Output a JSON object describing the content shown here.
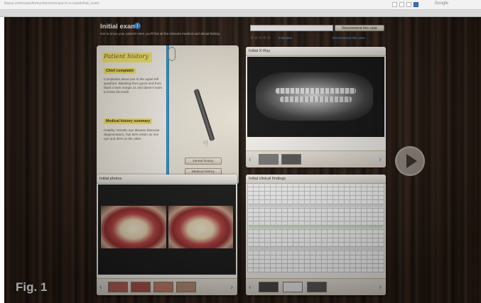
{
  "browser": {
    "url": "itepus.com/cases/tomuchtersom/case-in-a-case/initial_exam",
    "search_hint": "Google"
  },
  "header": {
    "title": "Initial exam",
    "subtitle": "Get to know your patient! Here you'll find all the relevant medical and dental history",
    "comment_placeholder": "",
    "comment_button": "Recommend this case",
    "review_link": "0 Review",
    "case_link": "Recommend this case",
    "stars": "☆☆☆☆☆"
  },
  "history": {
    "title": "Patient history",
    "chief_heading": "Chief complaint",
    "chief_text": "Complaints about pus in the upper left quadrant. Bleeding from gums and from black crown margin 21 and doesn't want to loose the tooth.",
    "medical_heading": "Medical history summary",
    "medical_text": "Healthy. Genetic eye disease (Macular degeneration), has 60% vision on one eye and 30% on the other.",
    "dental_btn": "Dental history",
    "medical_btn": "Medical history"
  },
  "xray": {
    "title": "Initial X-Ray"
  },
  "photos": {
    "title": "Initial photos"
  },
  "findings": {
    "title": "Initial clinical findings"
  },
  "nav": {
    "left": "‹",
    "right": "›"
  },
  "figure_label": "Fig. 1",
  "colors": {
    "accent": "#52a8e8",
    "highlight": "#f5e15a",
    "spine": "#2f8fc2"
  }
}
